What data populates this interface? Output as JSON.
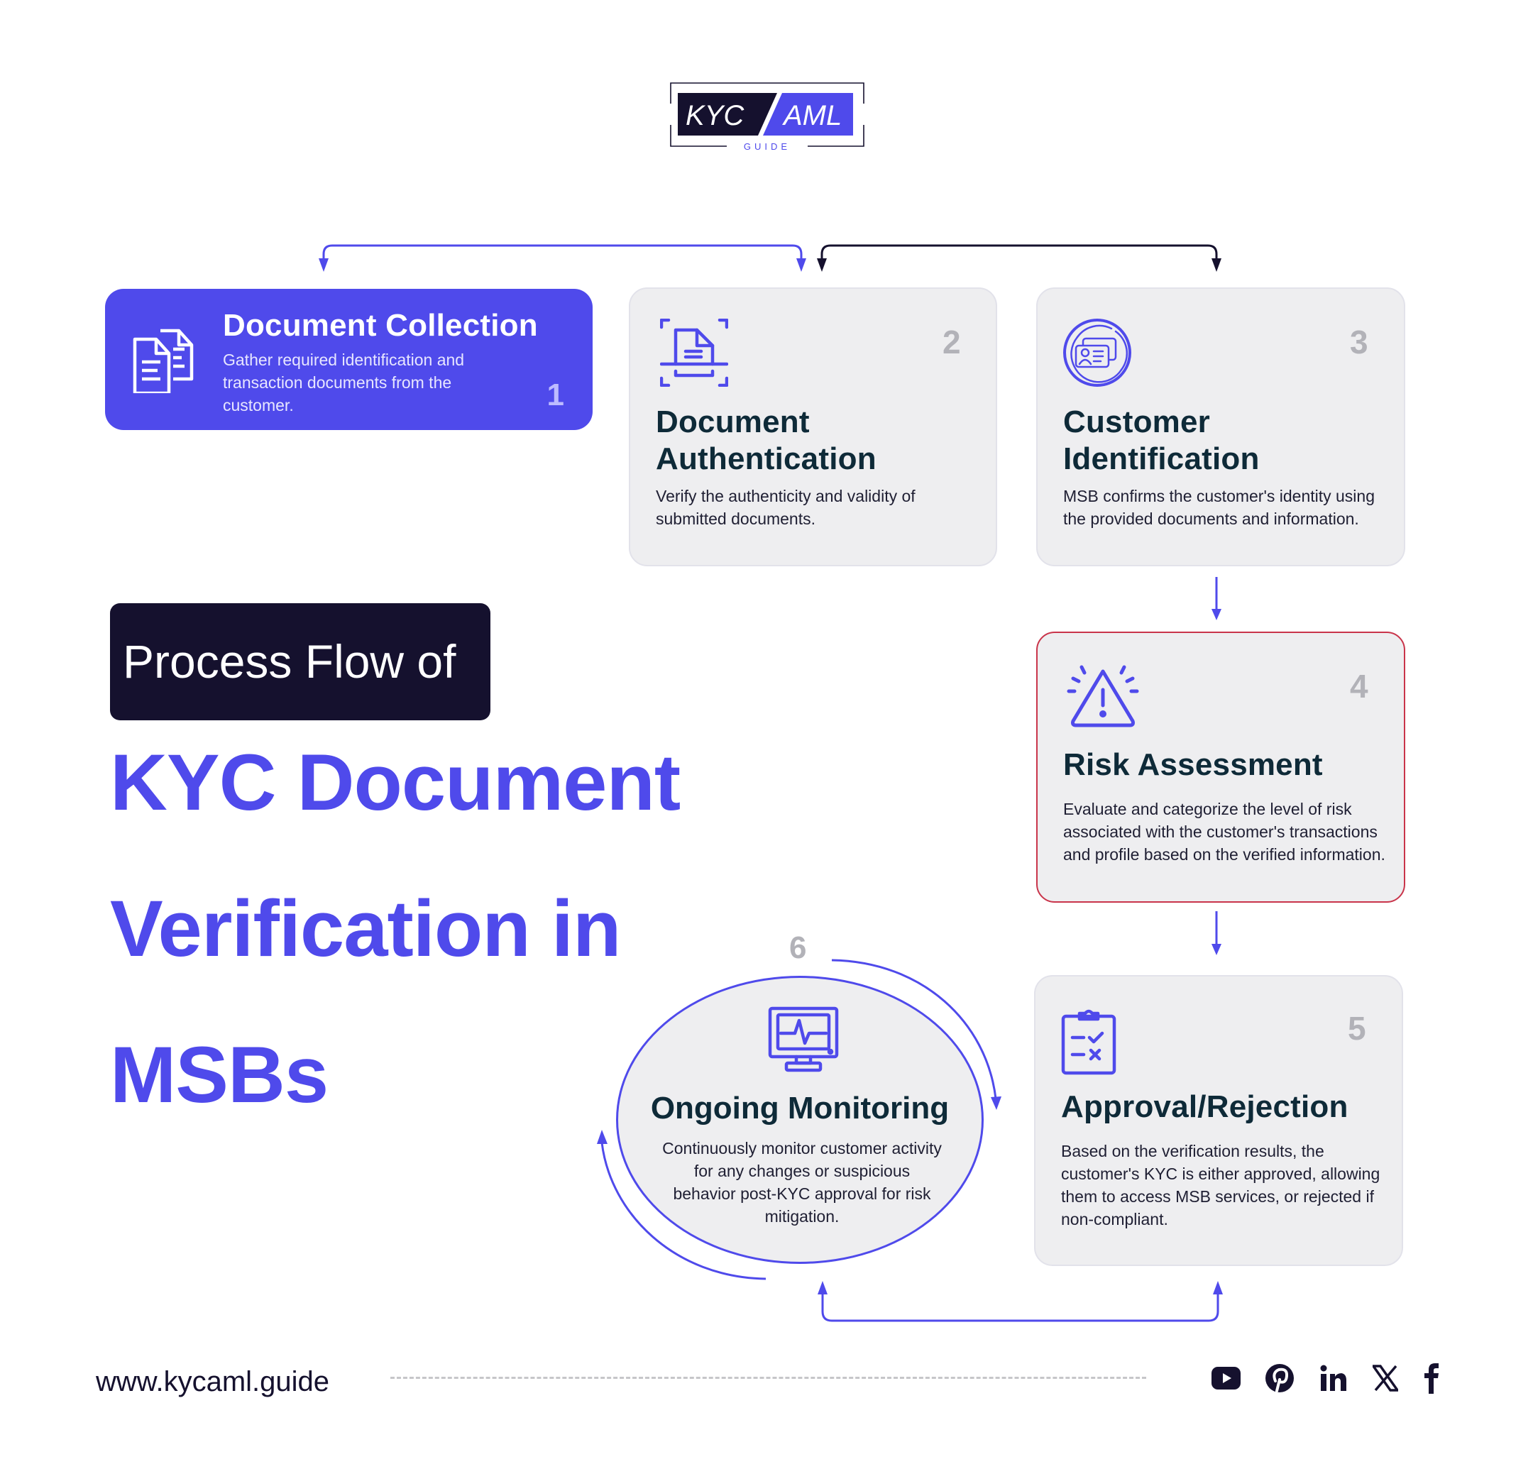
{
  "logo": {
    "left_text": "KYC",
    "right_text": "AML",
    "sub_text": "GUIDE"
  },
  "colors": {
    "accent": "#4f4aeb",
    "dark": "#15112e",
    "card_bg": "#eeeef0",
    "title_text": "#0e2a38",
    "highlight_border": "#c9344a",
    "step_number": "#b2b2b8"
  },
  "headline": {
    "badge": "Process Flow of",
    "title_lines": [
      "KYC Document",
      "Verification in",
      "MSBs"
    ]
  },
  "steps": [
    {
      "number": "1",
      "icon": "documents-icon",
      "title": "Document Collection",
      "description": "Gather required identification and transaction documents from the customer."
    },
    {
      "number": "2",
      "icon": "document-scan-icon",
      "title": "Document Authentication",
      "description": "Verify the authenticity and validity of submitted documents."
    },
    {
      "number": "3",
      "icon": "id-card-icon",
      "title": "Customer Identification",
      "description": "MSB confirms the customer's identity using the provided documents and information."
    },
    {
      "number": "4",
      "icon": "warning-alert-icon",
      "title": "Risk Assessment",
      "description": "Evaluate and categorize the level of risk associated with the customer's transactions and profile based on the verified information."
    },
    {
      "number": "5",
      "icon": "clipboard-checklist-icon",
      "title": "Approval/Rejection",
      "description": "Based on the verification results, the customer's KYC is either approved, allowing them to access MSB services, or rejected if non-compliant."
    },
    {
      "number": "6",
      "icon": "monitor-pulse-icon",
      "title": "Ongoing Monitoring",
      "description": "Continuously monitor customer activity for any changes or suspicious behavior post-KYC approval for risk mitigation."
    }
  ],
  "footer": {
    "url": "www.kycaml.guide",
    "social": [
      "youtube-icon",
      "pinterest-icon",
      "linkedin-icon",
      "x-icon",
      "facebook-icon"
    ]
  }
}
